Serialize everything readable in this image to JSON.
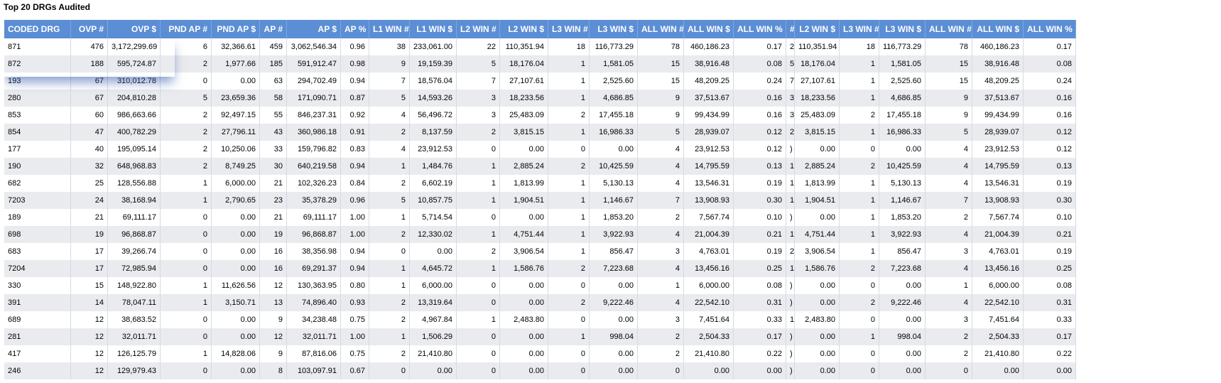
{
  "title": "Top 20 DRGs Audited",
  "headers": [
    "CODED DRG",
    "OVP #",
    "OVP $",
    "PND AP #",
    "PND AP $",
    "AP #",
    "AP $",
    "AP %",
    "L1 WIN #",
    "L1 WIN $",
    "L2 WIN #",
    "L2 WIN $",
    "L3 WIN #",
    "L3 WIN $",
    "ALL WIN #",
    "ALL WIN $",
    "ALL WIN %",
    "#",
    "L2 WIN $",
    "L3 WIN #",
    "L3 WIN $",
    "ALL WIN #",
    "ALL WIN $",
    "ALL WIN %"
  ],
  "rows": [
    [
      "871",
      "476",
      "3,172,299.69",
      "6",
      "32,366.61",
      "459",
      "3,062,546.34",
      "0.96",
      "38",
      "233,061.00",
      "22",
      "110,351.94",
      "18",
      "116,773.29",
      "78",
      "460,186.23",
      "0.17",
      "2",
      "110,351.94",
      "18",
      "116,773.29",
      "78",
      "460,186.23",
      "0.17"
    ],
    [
      "872",
      "188",
      "595,724.87",
      "2",
      "1,977.66",
      "185",
      "591,912.47",
      "0.98",
      "9",
      "19,159.39",
      "5",
      "18,176.04",
      "1",
      "1,581.05",
      "15",
      "38,916.48",
      "0.08",
      "5",
      "18,176.04",
      "1",
      "1,581.05",
      "15",
      "38,916.48",
      "0.08"
    ],
    [
      "193",
      "67",
      "310,012.78",
      "0",
      "0.00",
      "63",
      "294,702.49",
      "0.94",
      "7",
      "18,576.04",
      "7",
      "27,107.61",
      "1",
      "2,525.60",
      "15",
      "48,209.25",
      "0.24",
      "7",
      "27,107.61",
      "1",
      "2,525.60",
      "15",
      "48,209.25",
      "0.24"
    ],
    [
      "280",
      "67",
      "204,810.28",
      "5",
      "23,659.36",
      "58",
      "171,090.71",
      "0.87",
      "5",
      "14,593.26",
      "3",
      "18,233.56",
      "1",
      "4,686.85",
      "9",
      "37,513.67",
      "0.16",
      "3",
      "18,233.56",
      "1",
      "4,686.85",
      "9",
      "37,513.67",
      "0.16"
    ],
    [
      "853",
      "60",
      "986,663.66",
      "2",
      "92,497.15",
      "55",
      "846,237.31",
      "0.92",
      "4",
      "56,496.72",
      "3",
      "25,483.09",
      "2",
      "17,455.18",
      "9",
      "99,434.99",
      "0.16",
      "3",
      "25,483.09",
      "2",
      "17,455.18",
      "9",
      "99,434.99",
      "0.16"
    ],
    [
      "854",
      "47",
      "400,782.29",
      "2",
      "27,796.11",
      "43",
      "360,986.18",
      "0.91",
      "2",
      "8,137.59",
      "2",
      "3,815.15",
      "1",
      "16,986.33",
      "5",
      "28,939.07",
      "0.12",
      "2",
      "3,815.15",
      "1",
      "16,986.33",
      "5",
      "28,939.07",
      "0.12"
    ],
    [
      "177",
      "40",
      "195,095.14",
      "2",
      "10,250.06",
      "33",
      "159,796.82",
      "0.83",
      "4",
      "23,912.53",
      "0",
      "0.00",
      "0",
      "0.00",
      "4",
      "23,912.53",
      "0.12",
      ")",
      "0.00",
      "0",
      "0.00",
      "4",
      "23,912.53",
      "0.12"
    ],
    [
      "190",
      "32",
      "648,968.83",
      "2",
      "8,749.25",
      "30",
      "640,219.58",
      "0.94",
      "1",
      "1,484.76",
      "1",
      "2,885.24",
      "2",
      "10,425.59",
      "4",
      "14,795.59",
      "0.13",
      "1",
      "2,885.24",
      "2",
      "10,425.59",
      "4",
      "14,795.59",
      "0.13"
    ],
    [
      "682",
      "25",
      "128,556.88",
      "1",
      "6,000.00",
      "21",
      "102,326.23",
      "0.84",
      "2",
      "6,602.19",
      "1",
      "1,813.99",
      "1",
      "5,130.13",
      "4",
      "13,546.31",
      "0.19",
      "1",
      "1,813.99",
      "1",
      "5,130.13",
      "4",
      "13,546.31",
      "0.19"
    ],
    [
      "7203",
      "24",
      "38,168.94",
      "1",
      "2,790.65",
      "23",
      "35,378.29",
      "0.96",
      "5",
      "10,857.75",
      "1",
      "1,904.51",
      "1",
      "1,146.67",
      "7",
      "13,908.93",
      "0.30",
      "1",
      "1,904.51",
      "1",
      "1,146.67",
      "7",
      "13,908.93",
      "0.30"
    ],
    [
      "189",
      "21",
      "69,111.17",
      "0",
      "0.00",
      "21",
      "69,111.17",
      "1.00",
      "1",
      "5,714.54",
      "0",
      "0.00",
      "1",
      "1,853.20",
      "2",
      "7,567.74",
      "0.10",
      ")",
      "0.00",
      "1",
      "1,853.20",
      "2",
      "7,567.74",
      "0.10"
    ],
    [
      "698",
      "19",
      "96,868.87",
      "0",
      "0.00",
      "19",
      "96,868.87",
      "1.00",
      "2",
      "12,330.02",
      "1",
      "4,751.44",
      "1",
      "3,922.93",
      "4",
      "21,004.39",
      "0.21",
      "1",
      "4,751.44",
      "1",
      "3,922.93",
      "4",
      "21,004.39",
      "0.21"
    ],
    [
      "683",
      "17",
      "39,266.74",
      "0",
      "0.00",
      "16",
      "38,356.98",
      "0.94",
      "0",
      "0.00",
      "2",
      "3,906.54",
      "1",
      "856.47",
      "3",
      "4,763.01",
      "0.19",
      "2",
      "3,906.54",
      "1",
      "856.47",
      "3",
      "4,763.01",
      "0.19"
    ],
    [
      "7204",
      "17",
      "72,985.94",
      "0",
      "0.00",
      "16",
      "69,291.37",
      "0.94",
      "1",
      "4,645.72",
      "1",
      "1,586.76",
      "2",
      "7,223.68",
      "4",
      "13,456.16",
      "0.25",
      "1",
      "1,586.76",
      "2",
      "7,223.68",
      "4",
      "13,456.16",
      "0.25"
    ],
    [
      "330",
      "15",
      "148,922.80",
      "1",
      "11,626.56",
      "12",
      "130,363.95",
      "0.80",
      "1",
      "6,000.00",
      "0",
      "0.00",
      "0",
      "0.00",
      "1",
      "6,000.00",
      "0.08",
      ")",
      "0.00",
      "0",
      "0.00",
      "1",
      "6,000.00",
      "0.08"
    ],
    [
      "391",
      "14",
      "78,047.11",
      "1",
      "3,150.71",
      "13",
      "74,896.40",
      "0.93",
      "2",
      "13,319.64",
      "0",
      "0.00",
      "2",
      "9,222.46",
      "4",
      "22,542.10",
      "0.31",
      ")",
      "0.00",
      "2",
      "9,222.46",
      "4",
      "22,542.10",
      "0.31"
    ],
    [
      "689",
      "12",
      "38,683.52",
      "0",
      "0.00",
      "9",
      "34,238.48",
      "0.75",
      "2",
      "4,967.84",
      "1",
      "2,483.80",
      "0",
      "0.00",
      "3",
      "7,451.64",
      "0.33",
      "1",
      "2,483.80",
      "0",
      "0.00",
      "3",
      "7,451.64",
      "0.33"
    ],
    [
      "281",
      "12",
      "32,011.71",
      "0",
      "0.00",
      "12",
      "32,011.71",
      "1.00",
      "1",
      "1,506.29",
      "0",
      "0.00",
      "1",
      "998.04",
      "2",
      "2,504.33",
      "0.17",
      ")",
      "0.00",
      "1",
      "998.04",
      "2",
      "2,504.33",
      "0.17"
    ],
    [
      "417",
      "12",
      "126,125.79",
      "1",
      "14,828.06",
      "9",
      "87,816.06",
      "0.75",
      "2",
      "21,410.80",
      "0",
      "0.00",
      "0",
      "0.00",
      "2",
      "21,410.80",
      "0.22",
      ")",
      "0.00",
      "0",
      "0.00",
      "2",
      "21,410.80",
      "0.22"
    ],
    [
      "246",
      "12",
      "129,979.43",
      "0",
      "0.00",
      "8",
      "103,097.91",
      "0.67",
      "0",
      "0.00",
      "0",
      "0.00",
      "0",
      "0.00",
      "0",
      "0.00",
      "0.00",
      ")",
      "0.00",
      "0",
      "0.00",
      "0",
      "0.00",
      "0.00"
    ]
  ]
}
